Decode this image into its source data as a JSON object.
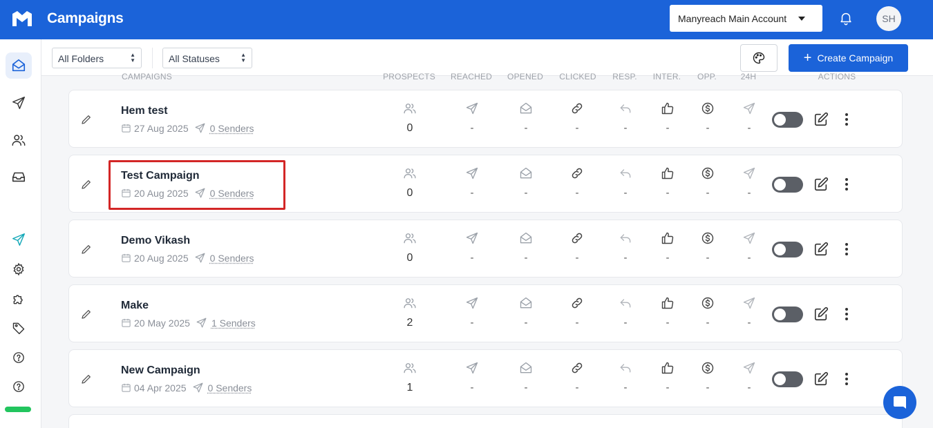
{
  "app": {
    "title": "Campaigns",
    "account": "Manyreach Main Account",
    "avatar_initials": "SH"
  },
  "filters": {
    "folders": "All Folders",
    "statuses": "All Statuses",
    "create_label": "Create Campaign"
  },
  "columns": {
    "campaigns": "CAMPAIGNS",
    "prospects": "PROSPECTS",
    "reached": "REACHED",
    "opened": "OPENED",
    "clicked": "CLICKED",
    "resp": "RESP.",
    "inter": "INTER.",
    "opp": "OPP.",
    "h24": "24H",
    "actions": "ACTIONS"
  },
  "campaigns": [
    {
      "name": "Hem test",
      "date": "27 Aug 2025",
      "senders": "0 Senders",
      "prospects": "0",
      "reached": "-",
      "opened": "-",
      "clicked": "-",
      "resp": "-",
      "inter": "-",
      "opp": "-",
      "h24": "-"
    },
    {
      "name": "Test Campaign",
      "date": "20 Aug 2025",
      "senders": "0 Senders",
      "prospects": "0",
      "reached": "-",
      "opened": "-",
      "clicked": "-",
      "resp": "-",
      "inter": "-",
      "opp": "-",
      "h24": "-"
    },
    {
      "name": "Demo Vikash",
      "date": "20 Aug 2025",
      "senders": "0 Senders",
      "prospects": "0",
      "reached": "-",
      "opened": "-",
      "clicked": "-",
      "resp": "-",
      "inter": "-",
      "opp": "-",
      "h24": "-"
    },
    {
      "name": "Make",
      "date": "20 May 2025",
      "senders": "1 Senders",
      "prospects": "2",
      "reached": "-",
      "opened": "-",
      "clicked": "-",
      "resp": "-",
      "inter": "-",
      "opp": "-",
      "h24": "-"
    },
    {
      "name": "New Campaign",
      "date": "04 Apr 2025",
      "senders": "0 Senders",
      "prospects": "1",
      "reached": "-",
      "opened": "-",
      "clicked": "-",
      "resp": "-",
      "inter": "-",
      "opp": "-",
      "h24": "-"
    }
  ],
  "colors": {
    "brand": "#1b63d9",
    "highlight": "#d32626",
    "green": "#22c55e"
  },
  "icons": {
    "sidebar": [
      "mail-icon",
      "send-icon",
      "users-icon",
      "inbox-icon",
      "send-active-icon",
      "gear-icon",
      "puzzle-icon",
      "tag-icon",
      "help-icon",
      "help-icon"
    ],
    "metrics": [
      "users-icon",
      "send-icon",
      "open-mail-icon",
      "link-icon",
      "reply-icon",
      "thumbs-up-icon",
      "dollar-icon",
      "send-icon"
    ]
  }
}
